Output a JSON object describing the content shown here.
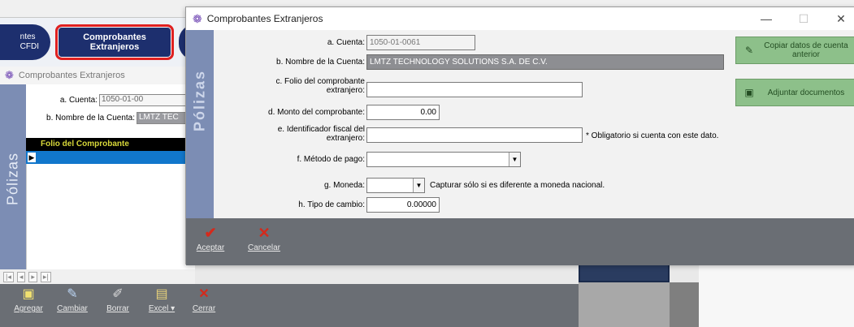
{
  "background_app": {
    "nav": {
      "cfdi_label": "ntes\nCFDI",
      "extranjeros_label": "Comprobantes\nExtranjeros"
    },
    "subtitle": "Comprobantes Extranjeros",
    "side_label": "Pólizas",
    "cuenta_label": "a. Cuenta:",
    "cuenta_value": "1050-01-00",
    "nombre_label": "b. Nombre de la Cuenta:",
    "nombre_value": "LMTZ TEC",
    "grid_header": "Folio del Comprobante",
    "bottom_toolbar": [
      {
        "label": "Agregar",
        "icon": "add-icon"
      },
      {
        "label": "Cambiar",
        "icon": "edit-icon"
      },
      {
        "label": "Borrar",
        "icon": "erase-icon"
      },
      {
        "label": "Excel ▾",
        "icon": "excel-icon"
      },
      {
        "label": "Cerrar",
        "icon": "close-icon"
      }
    ]
  },
  "dialog": {
    "title": "Comprobantes Extranjeros",
    "side_label": "Pólizas",
    "fields": {
      "cuenta": {
        "label": "a. Cuenta:",
        "value": "1050-01-0061"
      },
      "nombre": {
        "label": "b. Nombre de la Cuenta:",
        "value": "LMTZ TECHNOLOGY SOLUTIONS S.A. DE C.V."
      },
      "folio": {
        "label": "c. Folio del comprobante extranjero:",
        "value": ""
      },
      "monto": {
        "label": "d. Monto del comprobante:",
        "value": "0.00"
      },
      "identificador": {
        "label": "e. Identificador fiscal del extranjero:",
        "value": "",
        "note": "* Obligatorio si cuenta con este dato."
      },
      "metodo": {
        "label": "f. Método de pago:",
        "value": ""
      },
      "moneda": {
        "label": "g. Moneda:",
        "value": "",
        "note": "Capturar sólo si es diferente a moneda nacional."
      },
      "tipo_cambio": {
        "label": "h. Tipo de cambio:",
        "value": "0.00000"
      }
    },
    "buttons": {
      "copiar": "Copiar datos de cuenta anterior",
      "adjuntar": "Adjuntar documentos"
    },
    "footer": {
      "aceptar": "Aceptar",
      "cancelar": "Cancelar"
    },
    "colors": {
      "accept": "#d42a1c",
      "cancel": "#d42a1c",
      "side_panel": "#7c8db4",
      "green_button": "#8dc08a"
    }
  }
}
